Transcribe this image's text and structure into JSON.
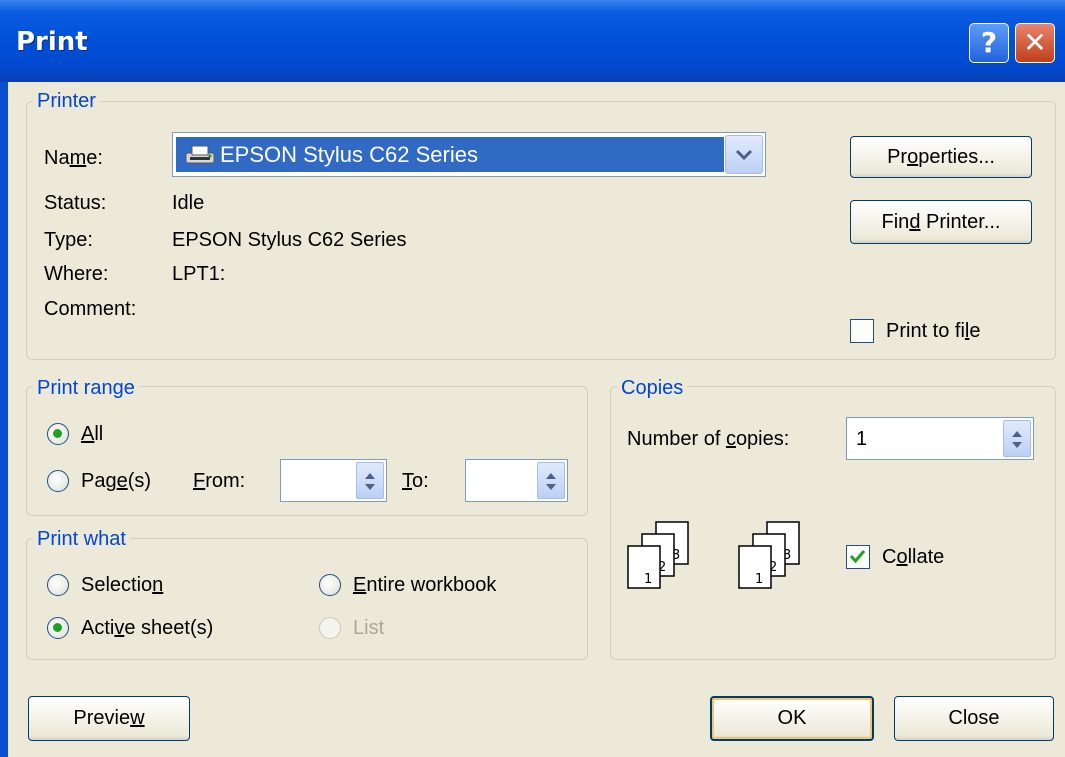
{
  "window": {
    "title": "Print",
    "help_glyph": "?",
    "close_glyph": "✕"
  },
  "printer": {
    "legend": "Printer",
    "name_label": "Name:",
    "selected_printer": "EPSON Stylus C62 Series",
    "status_label": "Status:",
    "status_value": "Idle",
    "type_label": "Type:",
    "type_value": "EPSON Stylus C62 Series",
    "where_label": "Where:",
    "where_value": "LPT1:",
    "comment_label": "Comment:",
    "properties_button": "Properties...",
    "find_printer_button": "Find Printer...",
    "print_to_file_label": "Print to file",
    "print_to_file_checked": false
  },
  "print_range": {
    "legend": "Print range",
    "all_label": "All",
    "pages_label": "Page(s)",
    "from_label": "From:",
    "from_value": "",
    "to_label": "To:",
    "to_value": "",
    "selected": "all"
  },
  "print_what": {
    "legend": "Print what",
    "selection_label": "Selection",
    "entire_workbook_label": "Entire workbook",
    "active_sheets_label": "Active sheet(s)",
    "list_label": "List",
    "selected": "active_sheets"
  },
  "copies": {
    "legend": "Copies",
    "number_label": "Number of copies:",
    "number_value": "1",
    "collate_label": "Collate",
    "collate_checked": true,
    "page_numbers": [
      "1",
      "2",
      "3"
    ]
  },
  "footer": {
    "preview_button": "Preview",
    "ok_button": "OK",
    "close_button": "Close"
  },
  "colors": {
    "titlebar": "#0150d8",
    "legend_text": "#0046d5",
    "selection": "#316ac5",
    "face": "#ece9d8"
  },
  "icons": [
    "help-icon",
    "close-icon",
    "printer-icon",
    "dropdown-arrow-icon",
    "spin-icon",
    "collate-pages-icon"
  ]
}
